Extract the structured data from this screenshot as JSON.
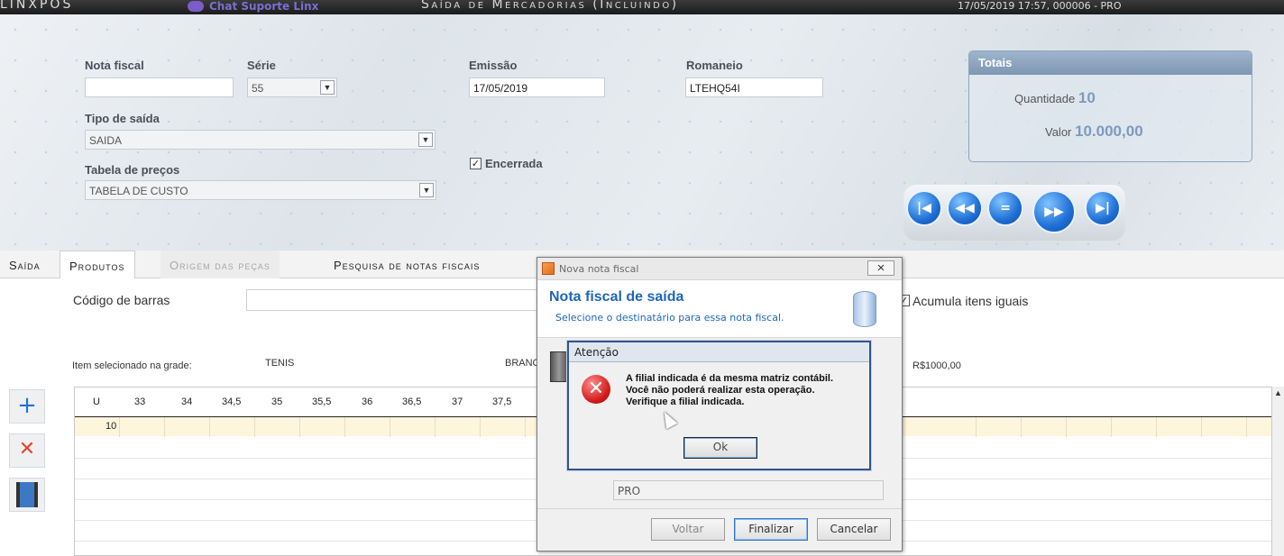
{
  "app": {
    "brand": "LINXPOS",
    "chat_label": "Chat Suporte Linx",
    "window_title": "Saída de Mercadorias (Incluindo)",
    "timestamp": "17/05/2019 17:57, 000006 - PRO"
  },
  "form": {
    "nota_fiscal_label": "Nota fiscal",
    "nota_fiscal_value": "",
    "serie_label": "Série",
    "serie_value": "55",
    "emissao_label": "Emissão",
    "emissao_value": "17/05/2019",
    "romaneio_label": "Romaneio",
    "romaneio_value": "LTEHQ54I",
    "tipo_saida_label": "Tipo de saída",
    "tipo_saida_value": "SAIDA",
    "tabela_precos_label": "Tabela de preços",
    "tabela_precos_value": "TABELA DE CUSTO",
    "encerrada_label": "Encerrada",
    "encerrada_checked": true
  },
  "totais": {
    "title": "Totais",
    "quantidade_label": "Quantidade",
    "quantidade_value": "10",
    "valor_label": "Valor",
    "valor_value": "10.000,00"
  },
  "nav_icons": [
    "first-icon",
    "previous-icon",
    "equals-icon",
    "next-icon",
    "last-icon"
  ],
  "tabs": [
    {
      "label": "Saída",
      "state": "normal"
    },
    {
      "label": "Produtos",
      "state": "active"
    },
    {
      "label": "Origem das peças",
      "state": "disabled"
    },
    {
      "label": "Pesquisa de notas fiscais",
      "state": "normal"
    }
  ],
  "produtos": {
    "codigo_barras_label": "Código de barras",
    "acumula_label": "Acumula itens iguais",
    "acumula_checked": true,
    "item_selecionado_label": "Item selecionado na grade:",
    "item_produto": "TENIS",
    "item_cor": "BRANC",
    "item_preco": "R$1000,00",
    "grid_headers": [
      "U",
      "33",
      "34",
      "34,5",
      "35",
      "35,5",
      "36",
      "36,5",
      "37",
      "37,5"
    ],
    "grid_row_values": [
      "10"
    ]
  },
  "dialog": {
    "title": "Nova nota fiscal",
    "heading": "Nota fiscal de saída",
    "subheading": "Selecione o destinatário para essa nota fiscal.",
    "filial_value": "PRO",
    "voltar": "Voltar",
    "finalizar": "Finalizar",
    "cancelar": "Cancelar"
  },
  "alert": {
    "title": "Atenção",
    "line1": "A filial indicada é da mesma matriz contábil.",
    "line2": "Você não poderá realizar esta operação.",
    "line3": "Verifique a filial indicada.",
    "ok": "Ok"
  },
  "colors": {
    "accent_blue": "#1f66b5",
    "error_red": "#d21a1a",
    "totais_header": "#8fa6c2",
    "grid_row_highlight": "#fdf5dc"
  }
}
